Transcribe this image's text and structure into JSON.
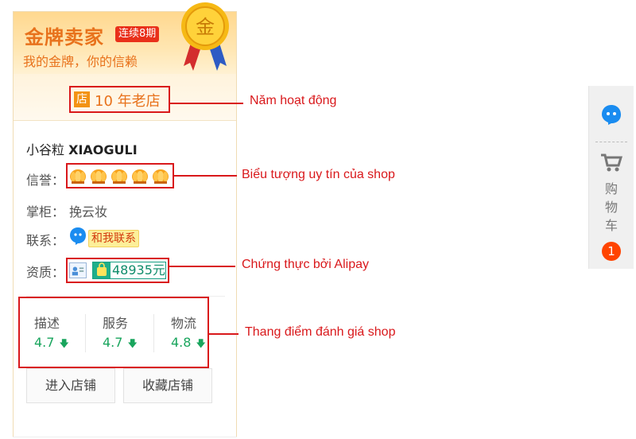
{
  "banner": {
    "title": "金牌卖家",
    "streak_badge": "连续8期",
    "subtitle": "我的金牌，你的信赖",
    "medal_char": "金"
  },
  "shop_age": {
    "icon_char": "店",
    "text": "10 年老店"
  },
  "shop": {
    "name_cn": "小谷粒",
    "name_en": "XIAOGULI",
    "reputation_label": "信誉：",
    "crown_count": 5,
    "owner_label": "掌柜：",
    "owner_value": "挽云妆",
    "contact_label": "联系：",
    "contact_button": "和我联系",
    "qualification_label": "资质：",
    "alipay_amount": "48935元"
  },
  "ratings": [
    {
      "name": "描述",
      "value": "4.7"
    },
    {
      "name": "服务",
      "value": "4.7"
    },
    {
      "name": "物流",
      "value": "4.8"
    }
  ],
  "buttons": {
    "enter_store": "进入店铺",
    "favorite_store": "收藏店铺"
  },
  "annotations": {
    "years": "Năm hoạt động",
    "reputation": "Biểu tượng uy tín của shop",
    "alipay": "Chứng thực bởi Alipay",
    "ratings": "Thang điểm đánh giá shop"
  },
  "sidebar": {
    "cart_label": [
      "购",
      "物",
      "车"
    ],
    "cart_count": "1"
  },
  "colors": {
    "annotation_red": "#d9181b",
    "gold_orange": "#e8721c",
    "rating_green": "#19a55d",
    "badge_orange": "#ff4400"
  }
}
